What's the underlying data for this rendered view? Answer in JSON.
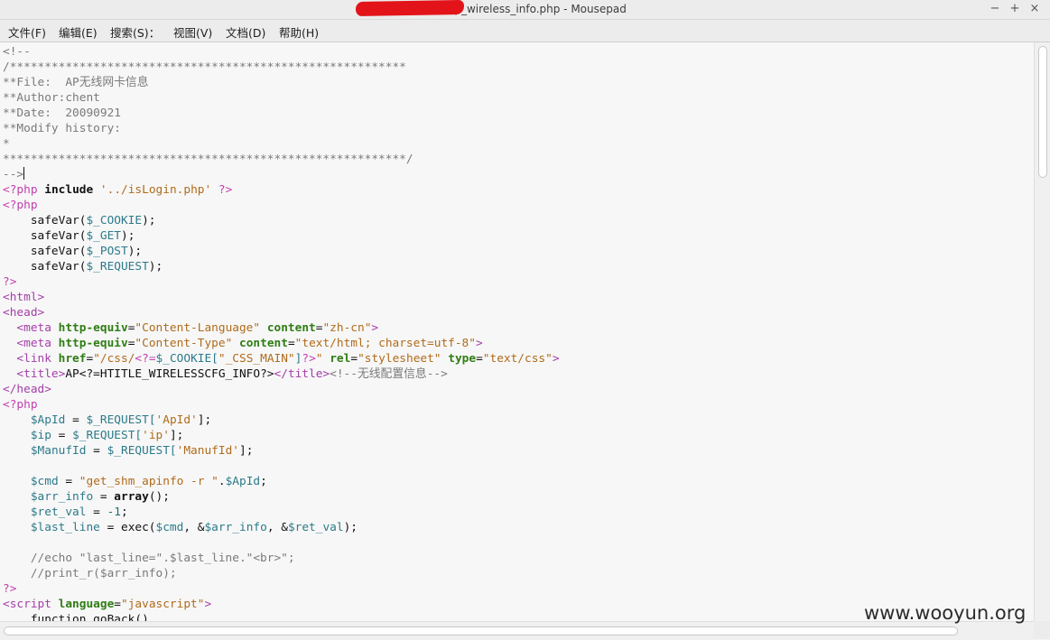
{
  "window": {
    "title": "/                              ap/ap_wireless_info.php - Mousepad",
    "controls": {
      "minimize": "−",
      "maximize": "+",
      "close": "×"
    }
  },
  "menu": [
    "文件(F)",
    "编辑(E)",
    "搜索(S)：",
    "视图(V)",
    "文档(D)",
    "帮助(H)"
  ],
  "code_lines": [
    [
      {
        "t": "<!--",
        "c": "c"
      }
    ],
    [
      {
        "t": "/*********************************************************",
        "c": "c"
      }
    ],
    [
      {
        "t": "**File:  AP无线网卡信息",
        "c": "c"
      }
    ],
    [
      {
        "t": "**Author:chent",
        "c": "c"
      }
    ],
    [
      {
        "t": "**Date:  20090921",
        "c": "c"
      }
    ],
    [
      {
        "t": "**Modify history:",
        "c": "c"
      }
    ],
    [
      {
        "t": "*",
        "c": "c"
      }
    ],
    [
      {
        "t": "**********************************************************/",
        "c": "c"
      }
    ],
    [
      {
        "t": "-->",
        "c": "c"
      }
    ],
    [
      {
        "t": "<?php",
        "c": "p"
      },
      {
        "t": " ",
        "c": ""
      },
      {
        "t": "include",
        "c": "k"
      },
      {
        "t": " ",
        "c": ""
      },
      {
        "t": "'../isLogin.php'",
        "c": "s"
      },
      {
        "t": " ",
        "c": ""
      },
      {
        "t": "?>",
        "c": "p"
      }
    ],
    [
      {
        "t": "<?php",
        "c": "p"
      }
    ],
    [
      {
        "t": "    safeVar(",
        "c": ""
      },
      {
        "t": "$_COOKIE",
        "c": "v"
      },
      {
        "t": ");",
        "c": ""
      }
    ],
    [
      {
        "t": "    safeVar(",
        "c": ""
      },
      {
        "t": "$_GET",
        "c": "v"
      },
      {
        "t": ");",
        "c": ""
      }
    ],
    [
      {
        "t": "    safeVar(",
        "c": ""
      },
      {
        "t": "$_POST",
        "c": "v"
      },
      {
        "t": ");",
        "c": ""
      }
    ],
    [
      {
        "t": "    safeVar(",
        "c": ""
      },
      {
        "t": "$_REQUEST",
        "c": "v"
      },
      {
        "t": ");",
        "c": ""
      }
    ],
    [
      {
        "t": "?>",
        "c": "p"
      }
    ],
    [
      {
        "t": "<html>",
        "c": "t"
      }
    ],
    [
      {
        "t": "<head>",
        "c": "t"
      }
    ],
    [
      {
        "t": "  <meta ",
        "c": "t"
      },
      {
        "t": "http-equiv",
        "c": "a"
      },
      {
        "t": "=",
        "c": ""
      },
      {
        "t": "\"Content-Language\"",
        "c": "s"
      },
      {
        "t": " ",
        "c": ""
      },
      {
        "t": "content",
        "c": "a"
      },
      {
        "t": "=",
        "c": ""
      },
      {
        "t": "\"zh-cn\"",
        "c": "s"
      },
      {
        "t": ">",
        "c": "t"
      }
    ],
    [
      {
        "t": "  <meta ",
        "c": "t"
      },
      {
        "t": "http-equiv",
        "c": "a"
      },
      {
        "t": "=",
        "c": ""
      },
      {
        "t": "\"Content-Type\"",
        "c": "s"
      },
      {
        "t": " ",
        "c": ""
      },
      {
        "t": "content",
        "c": "a"
      },
      {
        "t": "=",
        "c": ""
      },
      {
        "t": "\"text/html; charset=utf-8\"",
        "c": "s"
      },
      {
        "t": ">",
        "c": "t"
      }
    ],
    [
      {
        "t": "  <link ",
        "c": "t"
      },
      {
        "t": "href",
        "c": "a"
      },
      {
        "t": "=",
        "c": ""
      },
      {
        "t": "\"/css/",
        "c": "s"
      },
      {
        "t": "<?=",
        "c": "p"
      },
      {
        "t": "$_COOKIE[",
        "c": "v"
      },
      {
        "t": "\"_CSS_MAIN\"",
        "c": "s"
      },
      {
        "t": "]",
        "c": "v"
      },
      {
        "t": "?>",
        "c": "p"
      },
      {
        "t": "\"",
        "c": "s"
      },
      {
        "t": " ",
        "c": ""
      },
      {
        "t": "rel",
        "c": "a"
      },
      {
        "t": "=",
        "c": ""
      },
      {
        "t": "\"stylesheet\"",
        "c": "s"
      },
      {
        "t": " ",
        "c": ""
      },
      {
        "t": "type",
        "c": "a"
      },
      {
        "t": "=",
        "c": ""
      },
      {
        "t": "\"text/css\"",
        "c": "s"
      },
      {
        "t": ">",
        "c": "t"
      }
    ],
    [
      {
        "t": "  <title>",
        "c": "t"
      },
      {
        "t": "AP<?=HTITLE_WIRELESSCFG_INFO?>",
        "c": ""
      },
      {
        "t": "</title>",
        "c": "t"
      },
      {
        "t": "<!--无线配置信息-->",
        "c": "c"
      }
    ],
    [
      {
        "t": "</head>",
        "c": "t"
      }
    ],
    [
      {
        "t": "<?php",
        "c": "p"
      }
    ],
    [
      {
        "t": "    ",
        "c": ""
      },
      {
        "t": "$ApId",
        "c": "v"
      },
      {
        "t": " = ",
        "c": ""
      },
      {
        "t": "$_REQUEST[",
        "c": "v"
      },
      {
        "t": "'ApId'",
        "c": "s"
      },
      {
        "t": "];",
        "c": ""
      }
    ],
    [
      {
        "t": "    ",
        "c": ""
      },
      {
        "t": "$ip",
        "c": "v"
      },
      {
        "t": " = ",
        "c": ""
      },
      {
        "t": "$_REQUEST[",
        "c": "v"
      },
      {
        "t": "'ip'",
        "c": "s"
      },
      {
        "t": "];",
        "c": ""
      }
    ],
    [
      {
        "t": "    ",
        "c": ""
      },
      {
        "t": "$ManufId",
        "c": "v"
      },
      {
        "t": " = ",
        "c": ""
      },
      {
        "t": "$_REQUEST[",
        "c": "v"
      },
      {
        "t": "'ManufId'",
        "c": "s"
      },
      {
        "t": "];",
        "c": ""
      }
    ],
    [],
    [
      {
        "t": "    ",
        "c": ""
      },
      {
        "t": "$cmd",
        "c": "v"
      },
      {
        "t": " = ",
        "c": ""
      },
      {
        "t": "\"get_shm_apinfo -r \"",
        "c": "s"
      },
      {
        "t": ".",
        "c": ""
      },
      {
        "t": "$ApId",
        "c": "v"
      },
      {
        "t": ";",
        "c": ""
      }
    ],
    [
      {
        "t": "    ",
        "c": ""
      },
      {
        "t": "$arr_info",
        "c": "v"
      },
      {
        "t": " = ",
        "c": ""
      },
      {
        "t": "array",
        "c": "k"
      },
      {
        "t": "();",
        "c": ""
      }
    ],
    [
      {
        "t": "    ",
        "c": ""
      },
      {
        "t": "$ret_val",
        "c": "v"
      },
      {
        "t": " = ",
        "c": ""
      },
      {
        "t": "-1",
        "c": "n"
      },
      {
        "t": ";",
        "c": ""
      }
    ],
    [
      {
        "t": "    ",
        "c": ""
      },
      {
        "t": "$last_line",
        "c": "v"
      },
      {
        "t": " = exec(",
        "c": ""
      },
      {
        "t": "$cmd",
        "c": "v"
      },
      {
        "t": ", &",
        "c": ""
      },
      {
        "t": "$arr_info",
        "c": "v"
      },
      {
        "t": ", &",
        "c": ""
      },
      {
        "t": "$ret_val",
        "c": "v"
      },
      {
        "t": ");",
        "c": ""
      }
    ],
    [],
    [
      {
        "t": "    //echo \"last_line=\".$last_line.\"<br>\";",
        "c": "c"
      }
    ],
    [
      {
        "t": "    //print_r($arr_info);",
        "c": "c"
      }
    ],
    [
      {
        "t": "?>",
        "c": "p"
      }
    ],
    [
      {
        "t": "<script ",
        "c": "t"
      },
      {
        "t": "language",
        "c": "a"
      },
      {
        "t": "=",
        "c": ""
      },
      {
        "t": "\"javascript\"",
        "c": "s"
      },
      {
        "t": ">",
        "c": "t"
      }
    ],
    [
      {
        "t": "    function goBack()",
        "c": ""
      }
    ]
  ],
  "watermark": "www.wooyun.org",
  "colors": {
    "comment": "#7a7a7a",
    "php_tag": "#c13fae",
    "keyword": "#111111",
    "string": "#b06b1a",
    "variable": "#2c7a8a",
    "html_tag": "#a33ea8",
    "attribute": "#2f7d14",
    "redaction": "#e2141a"
  }
}
